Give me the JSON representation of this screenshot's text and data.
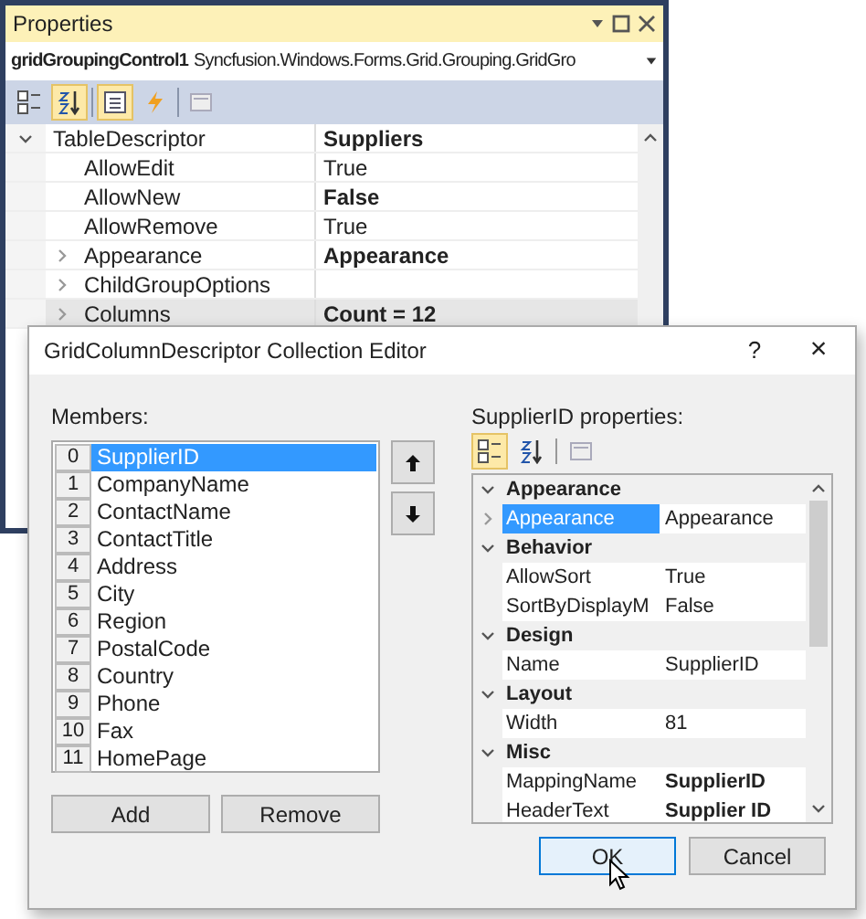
{
  "properties_window": {
    "title": "Properties",
    "object_name": "gridGroupingControl1",
    "object_type": "Syncfusion.Windows.Forms.Grid.Grouping.GridGro",
    "toolbar": [
      {
        "kind": "categorized",
        "selected": false
      },
      {
        "kind": "alphabetical",
        "selected": true
      },
      {
        "kind": "properties",
        "selected": true
      },
      {
        "kind": "events",
        "selected": false
      },
      {
        "kind": "pages",
        "selected": false
      }
    ],
    "rows": [
      {
        "name": "TableDescriptor",
        "value": "Suppliers",
        "bold": true,
        "expanded": true,
        "selected": false,
        "children": [
          {
            "name": "AllowEdit",
            "value": "True",
            "bold": false,
            "selected": false
          },
          {
            "name": "AllowNew",
            "value": "False",
            "bold": true,
            "selected": false
          },
          {
            "name": "AllowRemove",
            "value": "True",
            "bold": false,
            "selected": false
          },
          {
            "name": "Appearance",
            "value": "Appearance",
            "bold": true,
            "expanded": false,
            "selected": false
          },
          {
            "name": "ChildGroupOptions",
            "expanded": false,
            "selected": false
          },
          {
            "name": "Columns",
            "value": "Count = 12",
            "bold": true,
            "expanded": false,
            "selected": true
          }
        ]
      }
    ]
  },
  "dialog": {
    "title": "GridColumnDescriptor Collection Editor",
    "help": "?",
    "close": "×",
    "members_label": "Members:",
    "members": [
      {
        "index": "0",
        "name": "SupplierID",
        "selected": true
      },
      {
        "index": "1",
        "name": "CompanyName",
        "selected": false
      },
      {
        "index": "2",
        "name": "ContactName",
        "selected": false
      },
      {
        "index": "3",
        "name": "ContactTitle",
        "selected": false
      },
      {
        "index": "4",
        "name": "Address",
        "selected": false
      },
      {
        "index": "5",
        "name": "City",
        "selected": false
      },
      {
        "index": "6",
        "name": "Region",
        "selected": false
      },
      {
        "index": "7",
        "name": "PostalCode",
        "selected": false
      },
      {
        "index": "8",
        "name": "Country",
        "selected": false
      },
      {
        "index": "9",
        "name": "Phone",
        "selected": false
      },
      {
        "index": "10",
        "name": "Fax",
        "selected": false
      },
      {
        "index": "11",
        "name": "HomePage",
        "selected": false
      }
    ],
    "add": "Add",
    "remove": "Remove",
    "properties_label": "SupplierID properties:",
    "toolbar": [
      {
        "kind": "categorized",
        "selected": true
      },
      {
        "kind": "alphabetical",
        "selected": false
      },
      {
        "kind": "pages",
        "selected": false
      }
    ],
    "categories": [
      {
        "name": "Appearance",
        "expanded": true,
        "rows": [
          {
            "name": "Appearance",
            "value": "Appearance",
            "bold": false,
            "expandable": true,
            "selected": true
          }
        ]
      },
      {
        "name": "Behavior",
        "expanded": true,
        "rows": [
          {
            "name": "AllowSort",
            "value": "True",
            "bold": false,
            "expandable": false,
            "selected": false
          },
          {
            "name": "SortByDisplayM",
            "value": "False",
            "bold": false,
            "expandable": false,
            "selected": false
          }
        ]
      },
      {
        "name": "Design",
        "expanded": true,
        "rows": [
          {
            "name": "Name",
            "value": "SupplierID",
            "bold": false,
            "expandable": false,
            "selected": false
          }
        ]
      },
      {
        "name": "Layout",
        "expanded": true,
        "rows": [
          {
            "name": "Width",
            "value": "81",
            "bold": false,
            "expandable": false,
            "selected": false
          }
        ]
      },
      {
        "name": "Misc",
        "expanded": true,
        "rows": [
          {
            "name": "MappingName",
            "value": "SupplierID",
            "bold": true,
            "expandable": false,
            "selected": false
          },
          {
            "name": "HeaderText",
            "value": "Supplier ID",
            "bold": true,
            "expandable": false,
            "selected": false
          }
        ]
      }
    ],
    "ok": "OK",
    "cancel": "Cancel"
  }
}
